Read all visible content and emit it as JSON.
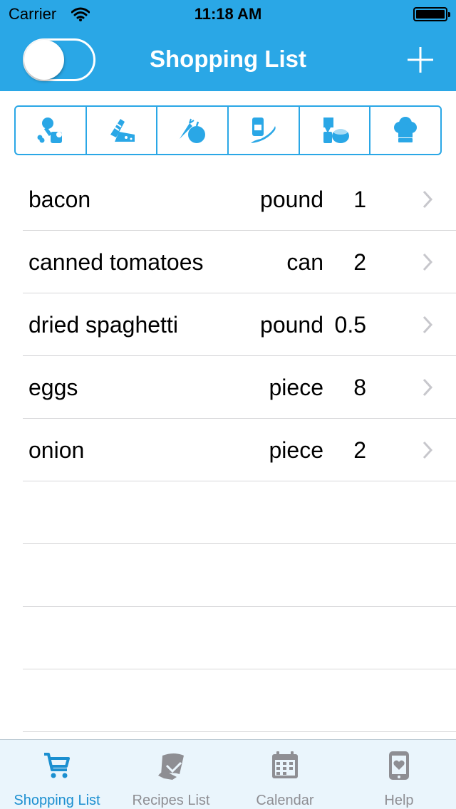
{
  "status_bar": {
    "carrier": "Carrier",
    "time": "11:18 AM"
  },
  "nav": {
    "title": "Shopping List",
    "toggle_on": false,
    "add_icon": "plus-icon"
  },
  "categories": [
    {
      "icon": "meat-category-icon"
    },
    {
      "icon": "bakery-dairy-category-icon"
    },
    {
      "icon": "produce-category-icon"
    },
    {
      "icon": "condiments-category-icon"
    },
    {
      "icon": "canned-goods-category-icon"
    },
    {
      "icon": "chef-hat-category-icon"
    }
  ],
  "items": [
    {
      "name": "bacon",
      "unit": "pound",
      "qty": "1"
    },
    {
      "name": "canned tomatoes",
      "unit": "can",
      "qty": "2"
    },
    {
      "name": "dried spaghetti",
      "unit": "pound",
      "qty": "0.5"
    },
    {
      "name": "eggs",
      "unit": "piece",
      "qty": "8"
    },
    {
      "name": "onion",
      "unit": "piece",
      "qty": "2"
    }
  ],
  "tabs": [
    {
      "label": "Shopping List",
      "icon": "cart-icon",
      "active": true
    },
    {
      "label": "Recipes List",
      "icon": "recipe-book-icon",
      "active": false
    },
    {
      "label": "Calendar",
      "icon": "calendar-icon",
      "active": false
    },
    {
      "label": "Help",
      "icon": "help-phone-icon",
      "active": false
    }
  ],
  "colors": {
    "accent": "#2aa7e6",
    "tab_active": "#1b8fd0",
    "tab_inactive": "#8e8e93",
    "tabbar_bg": "#eaf5fc"
  }
}
